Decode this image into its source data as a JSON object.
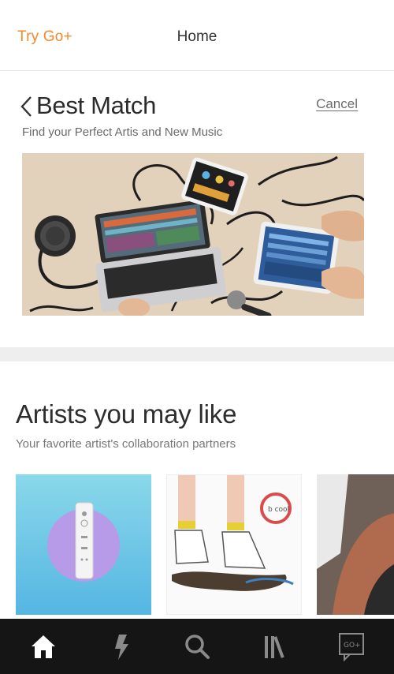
{
  "header": {
    "try_go_label": "Try Go+",
    "title": "Home"
  },
  "best_match": {
    "title": "Best Match",
    "cancel_label": "Cancel",
    "subtitle": "Find your Perfect Artis and New Music",
    "back_icon": "chevron-left-icon",
    "hero_image": "music-gear-photo"
  },
  "artists": {
    "title": "Artists you may like",
    "subtitle": "Your favorite artist's collaboration partners",
    "cards": [
      {
        "image": "remote-controller-illustration"
      },
      {
        "image": "sneakers-illustration"
      },
      {
        "image": "portrait-photo"
      }
    ]
  },
  "nav": {
    "items": [
      {
        "icon": "home-icon",
        "active": true
      },
      {
        "icon": "lightning-icon",
        "active": false
      },
      {
        "icon": "search-icon",
        "active": false
      },
      {
        "icon": "library-icon",
        "active": false
      },
      {
        "icon": "go-plus-icon",
        "active": false
      }
    ]
  },
  "colors": {
    "accent": "#f28a2e",
    "nav_bg": "#151515"
  }
}
